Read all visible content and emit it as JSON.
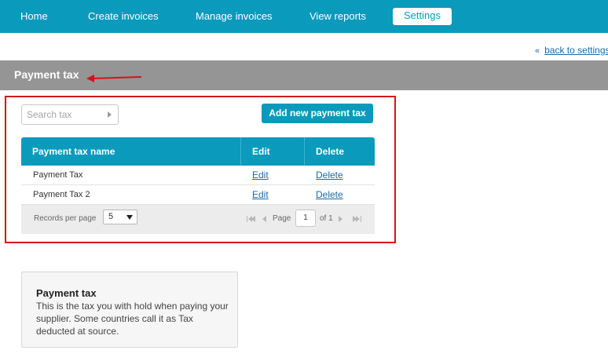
{
  "nav": {
    "items": [
      {
        "label": "Home"
      },
      {
        "label": "Create invoices"
      },
      {
        "label": "Manage invoices"
      },
      {
        "label": "View reports"
      },
      {
        "label": "Settings",
        "active": true
      }
    ]
  },
  "back_link": {
    "arrows": "«",
    "label": "back to settings"
  },
  "section": {
    "title": "Payment tax"
  },
  "toolbar": {
    "search_placeholder": "Search tax",
    "add_button_label": "Add new payment tax"
  },
  "table": {
    "columns": [
      "Payment tax name",
      "Edit",
      "Delete"
    ],
    "rows": [
      {
        "name": "Payment Tax",
        "edit": "Edit",
        "delete": "Delete"
      },
      {
        "name": "Payment Tax 2",
        "edit": "Edit",
        "delete": "Delete"
      }
    ],
    "footer": {
      "records_per_page_label": "Records per page",
      "records_per_page_value": "5",
      "page_label": "Page",
      "page_value": "1",
      "of_label": "of 1"
    }
  },
  "info": {
    "title": "Payment tax",
    "text": "This is the tax you with hold when paying your supplier. Some countries call it as Tax deducted at source."
  },
  "colors": {
    "accent": "#0a9abb",
    "section_bar": "#959595",
    "highlight": "#d3151b",
    "link": "#1a6aa6"
  }
}
